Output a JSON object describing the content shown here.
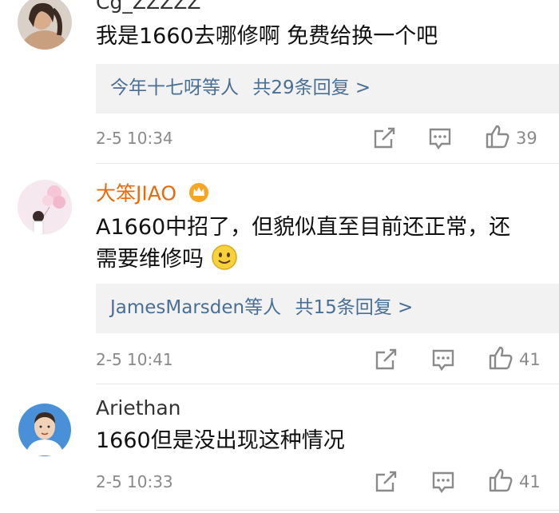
{
  "comments": [
    {
      "username": "Cg_ZZZZZ",
      "content": "我是1660去哪修啊 免费给换一个吧",
      "replies": {
        "users": "今年十七呀等人",
        "summary": "共29条回复 >"
      },
      "time": "2-5 10:34",
      "likes": "39"
    },
    {
      "username": "大笨JIAO",
      "content": "A1660中招了，但貌似直至目前还正常，还需要维修吗",
      "replies": {
        "users": "JamesMarsden等人",
        "summary": "共15条回复 >"
      },
      "time": "2-5 10:41",
      "likes": "41"
    },
    {
      "username": "Ariethan",
      "content": "1660但是没出现这种情况",
      "time": "2-5 10:33",
      "likes": "41"
    }
  ],
  "colors": {
    "link": "#4a6f96",
    "vip_name": "#e86b0c",
    "meta": "#8a8a8a",
    "reply_bg": "#f2f2f2"
  },
  "icons": [
    "share-icon",
    "comment-icon",
    "like-icon",
    "crown-icon",
    "smile-emoji"
  ]
}
